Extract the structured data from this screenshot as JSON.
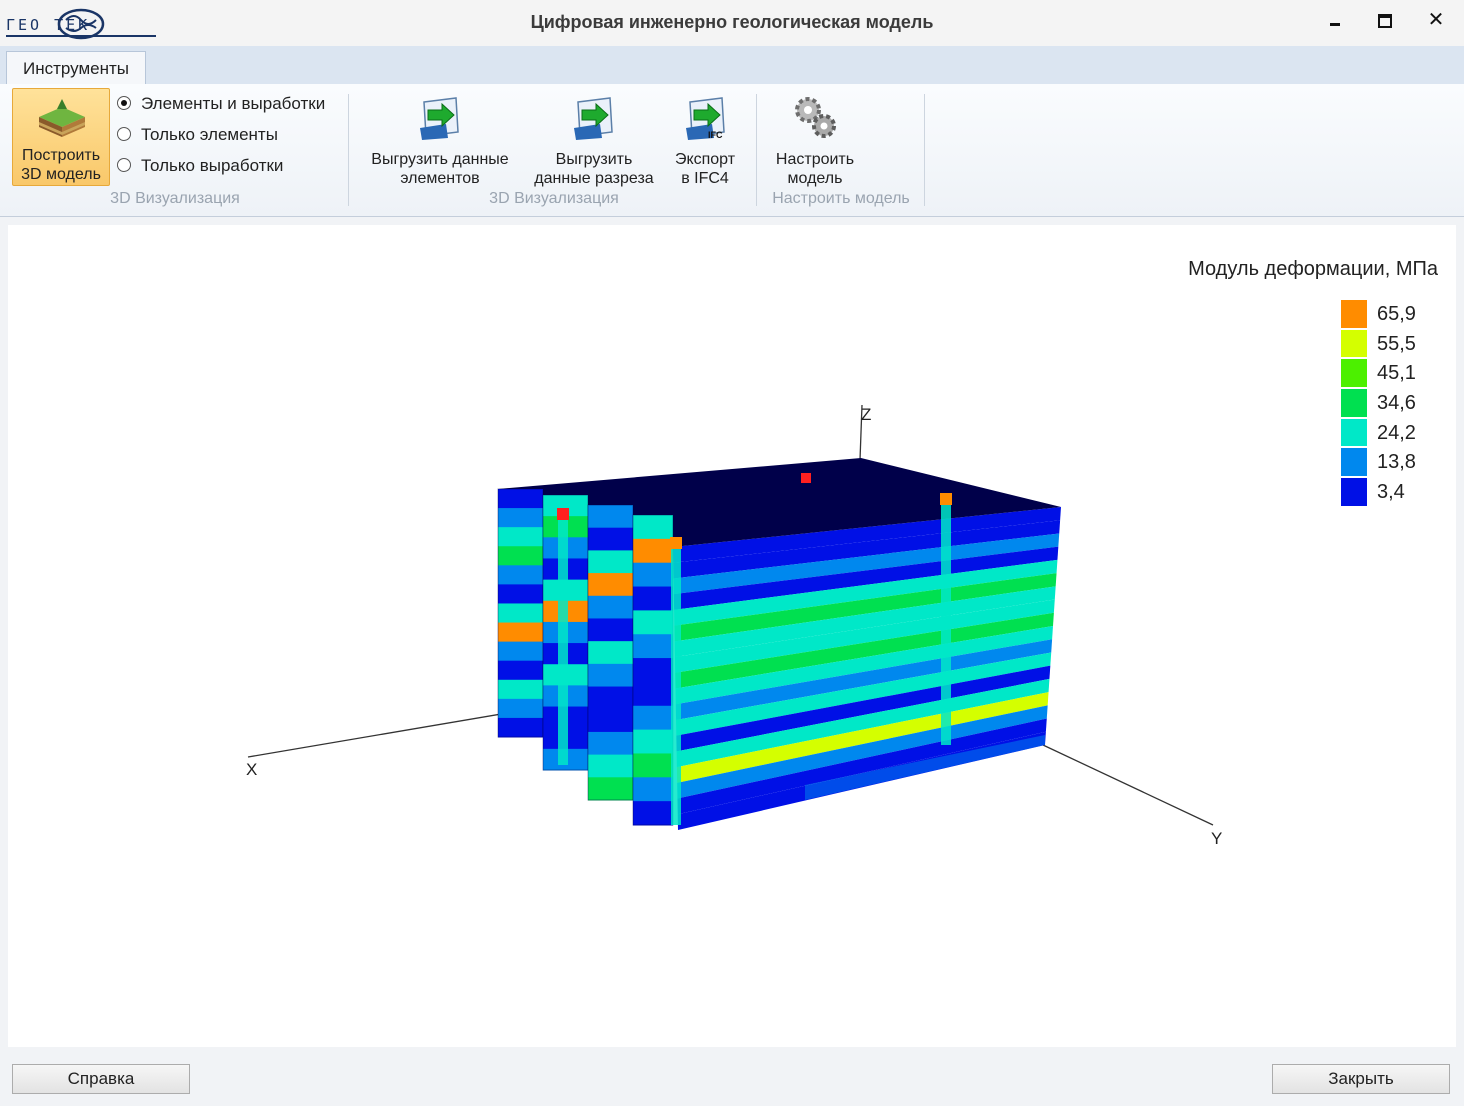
{
  "app": {
    "logo_text": "ГЕО ТЕК",
    "title": "Цифровая инженерно геологическая модель",
    "window_controls": {
      "minimize": "▬",
      "maximize": "🗖",
      "close": "✕"
    }
  },
  "tabs": [
    {
      "label": "Инструменты",
      "selected": true
    }
  ],
  "ribbon": {
    "build_button": {
      "line1": "Построить",
      "line2": "3D модель",
      "icon": "terrain-3d-icon"
    },
    "view_options": [
      {
        "label": "Элементы и выработки",
        "checked": true
      },
      {
        "label": "Только элементы",
        "checked": false
      },
      {
        "label": "Только выработки",
        "checked": false
      }
    ],
    "group1_label": "3D Визуализация",
    "export_elements": {
      "line1": "Выгрузить данные",
      "line2": "элементов",
      "icon": "export-arrow-icon"
    },
    "export_section": {
      "line1": "Выгрузить",
      "line2": "данные разреза",
      "icon": "export-arrow-icon"
    },
    "export_ifc": {
      "line1": "Экспорт",
      "line2": "в IFC4",
      "icon": "ifc-export-icon"
    },
    "group2_label": "3D Визуализация",
    "settings": {
      "line1": "Настроить",
      "line2": "модель",
      "icon": "gears-icon"
    },
    "group3_label": "Настроить модель"
  },
  "viewport": {
    "legend_title": "Модуль деформации, МПа",
    "legend": [
      {
        "value": "65,9",
        "color": "#ff8c00"
      },
      {
        "value": "55,5",
        "color": "#d4ff00"
      },
      {
        "value": "45,1",
        "color": "#4cf000"
      },
      {
        "value": "34,6",
        "color": "#00e050"
      },
      {
        "value": "24,2",
        "color": "#00e8c8"
      },
      {
        "value": "13,8",
        "color": "#0088ee"
      },
      {
        "value": "3,4",
        "color": "#0010e6"
      }
    ],
    "axes": {
      "x": "X",
      "y": "Y",
      "z": "Z"
    }
  },
  "footer": {
    "help": "Справка",
    "close": "Закрыть"
  }
}
